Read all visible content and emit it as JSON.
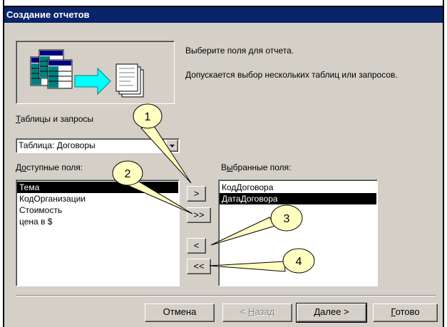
{
  "dialog": {
    "title": "Создание отчетов",
    "instruction": "Выберите поля для отчета.",
    "hint": "Допускается выбор нескольких таблиц или запросов."
  },
  "tables_label_key": "Т",
  "tables_label_rest": "аблицы и запросы",
  "tables_combo_value": "Таблица: Договоры",
  "available_label_pre": "Д",
  "available_label_key": "о",
  "available_label_rest": "ступные поля:",
  "selected_label_pre": "В",
  "selected_label_key": "ы",
  "selected_label_rest": "бранные поля:",
  "available_fields": [
    "Тема",
    "КодОрганизации",
    "Стоимость",
    "цена в $"
  ],
  "selected_fields": [
    "КодДоговора",
    "ДатаДоговора"
  ],
  "move_buttons": {
    "add_one": ">",
    "add_all": ">>",
    "remove_one": "<",
    "remove_all": "<<"
  },
  "footer": {
    "cancel": "Отмена",
    "back_pre": "< ",
    "back_key": "Н",
    "back_rest": "азад",
    "next_key": "Д",
    "next_rest": "алее >",
    "finish_key": "Г",
    "finish_rest": "отово"
  },
  "callouts": [
    "1",
    "2",
    "3",
    "4"
  ],
  "colors": {
    "titlebar": "#0a246a",
    "dialog_bg": "#d4d0c8",
    "callout_fill": "#ffffc0",
    "selection": "#000000"
  },
  "icons": [
    "tables-to-report-illustration",
    "dropdown-arrow-icon"
  ]
}
